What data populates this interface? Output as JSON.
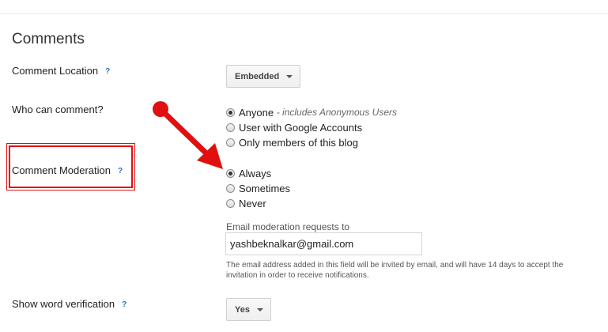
{
  "section": {
    "title": "Comments"
  },
  "comment_location": {
    "label": "Comment Location",
    "help": "?",
    "dropdown_value": "Embedded"
  },
  "who_can_comment": {
    "label": "Who can comment?",
    "options": [
      {
        "label": "Anyone",
        "note": "- includes Anonymous Users",
        "selected": true
      },
      {
        "label": "User with Google Accounts",
        "selected": false
      },
      {
        "label": "Only members of this blog",
        "selected": false
      }
    ]
  },
  "comment_moderation": {
    "label": "Comment Moderation",
    "help": "?",
    "options": [
      {
        "label": "Always",
        "selected": true
      },
      {
        "label": "Sometimes",
        "selected": false
      },
      {
        "label": "Never",
        "selected": false
      }
    ],
    "email_label": "Email moderation requests to",
    "email_value": "yashbeknalkar@gmail.com",
    "helper_text": "The email address added in this field will be invited by email, and will have 14 days to accept the invitation in order to receive notifications."
  },
  "word_verification": {
    "label": "Show word verification",
    "help": "?",
    "dropdown_value": "Yes"
  },
  "colors": {
    "annotation_red": "#e01010",
    "help_blue": "#2e6fc0"
  }
}
